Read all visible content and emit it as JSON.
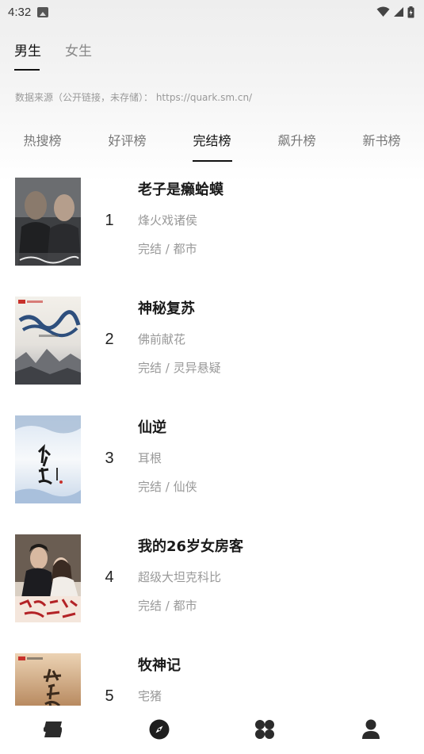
{
  "status_bar": {
    "time": "4:32"
  },
  "gender_tabs": [
    {
      "label": "男生",
      "active": true
    },
    {
      "label": "女生",
      "active": false
    }
  ],
  "source_note": "数据来源（公开链接，未存储）： https://quark.sm.cn/",
  "rank_tabs": [
    {
      "label": "热搜榜",
      "active": false
    },
    {
      "label": "好评榜",
      "active": false
    },
    {
      "label": "完结榜",
      "active": true
    },
    {
      "label": "飙升榜",
      "active": false
    },
    {
      "label": "新书榜",
      "active": false
    }
  ],
  "books": [
    {
      "rank": "1",
      "title": "老子是癞蛤蟆",
      "author": "烽火戏诸侯",
      "meta": "完结 / 都市"
    },
    {
      "rank": "2",
      "title": "神秘复苏",
      "author": "佛前献花",
      "meta": "完结 / 灵异悬疑"
    },
    {
      "rank": "3",
      "title": "仙逆",
      "author": "耳根",
      "meta": "完结 / 仙侠"
    },
    {
      "rank": "4",
      "title": "我的26岁女房客",
      "author": "超级大坦克科比",
      "meta": "完结 / 都市"
    },
    {
      "rank": "5",
      "title": "牧神记",
      "author": "宅猪",
      "meta": ""
    }
  ],
  "bottom_nav": [
    {
      "icon": "bookshelf-icon",
      "active": false
    },
    {
      "icon": "compass-icon",
      "active": true
    },
    {
      "icon": "category-icon",
      "active": false
    },
    {
      "icon": "profile-icon",
      "active": false
    }
  ],
  "colors": {
    "text_primary": "#111111",
    "text_secondary": "#999999",
    "icon": "#2b2b2b"
  }
}
